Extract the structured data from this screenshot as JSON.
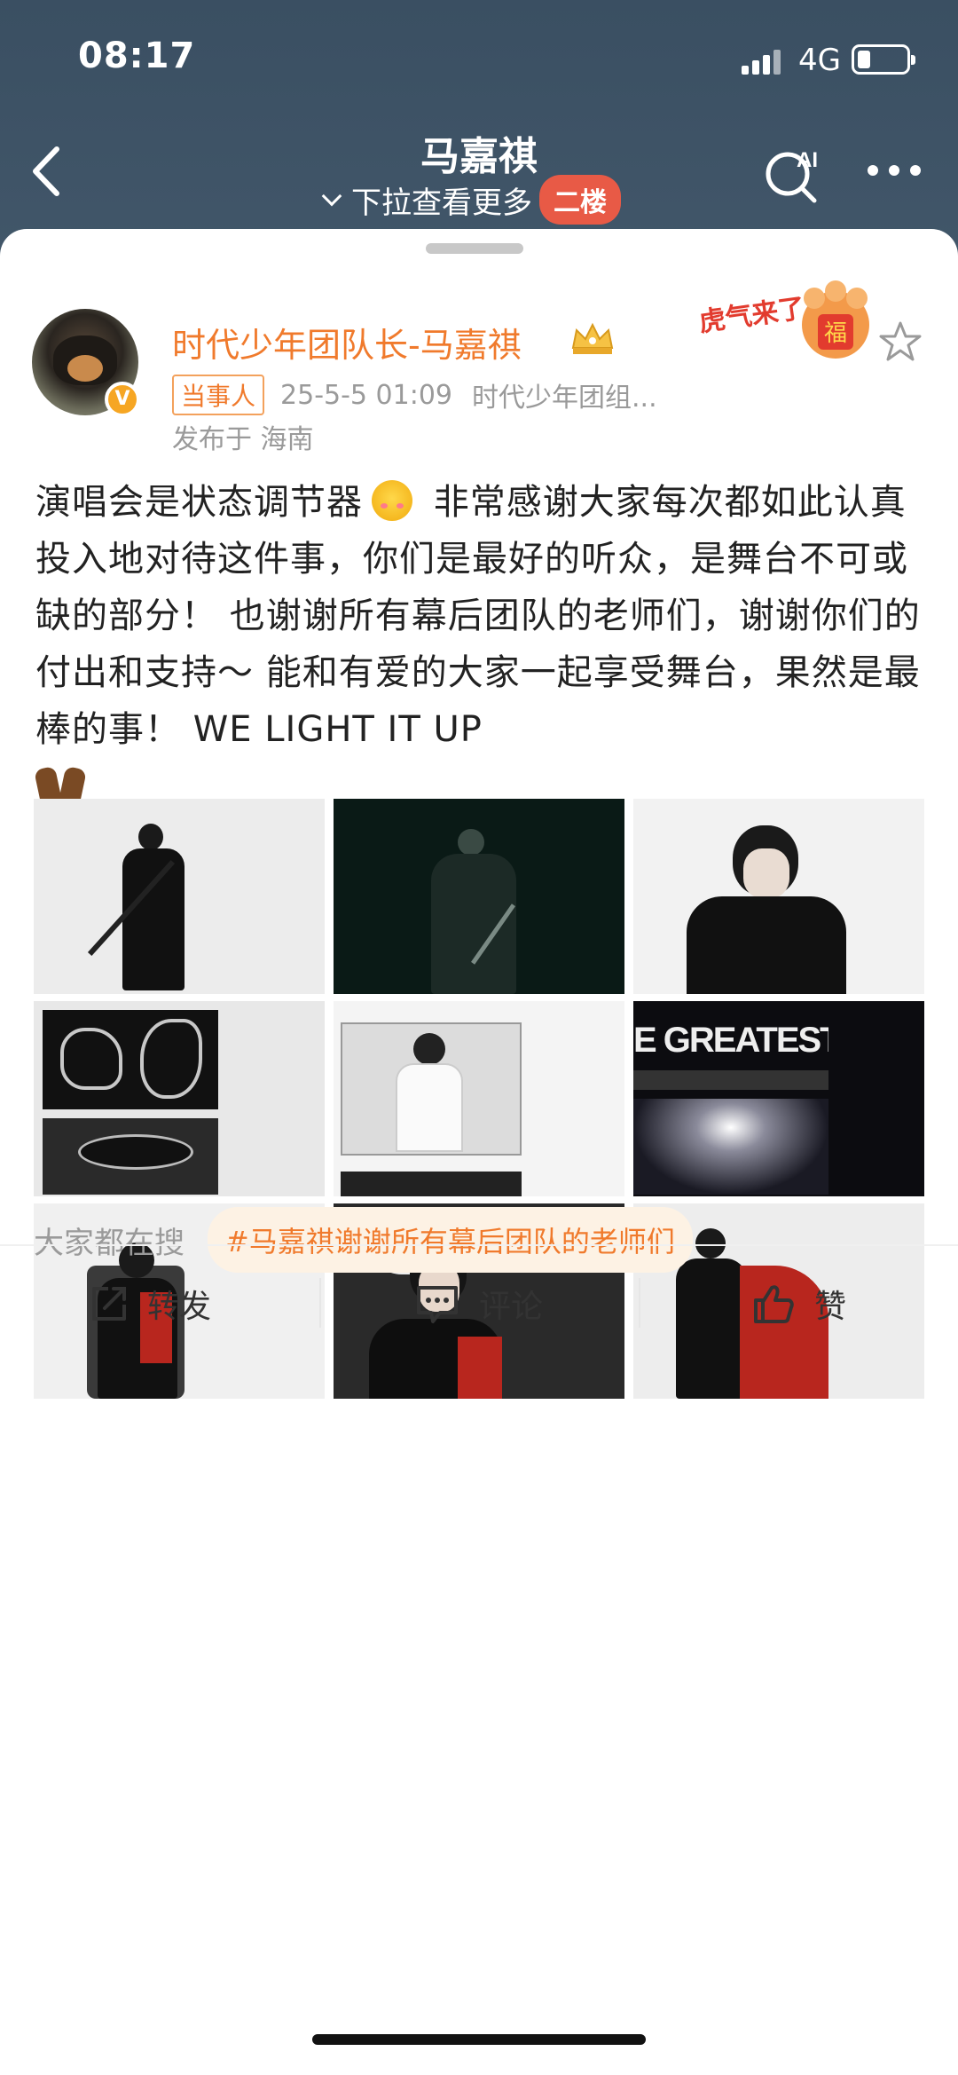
{
  "status_bar": {
    "time": "08:17",
    "network": "4G"
  },
  "nav": {
    "title": "马嘉祺",
    "subtitle": "下拉查看更多",
    "floor_badge": "二楼",
    "ai_label": "AI"
  },
  "post": {
    "author": "时代少年团队长-马嘉祺",
    "tag": "当事人",
    "time": "25-5-5 01:09",
    "source": "时代少年团组...",
    "location": "发布于 海南",
    "sticker_text": "虎气来了",
    "text_part1": "演唱会是状态调节器",
    "text_part2": " 非常感谢大家每次都如此认真投入地对待这件事，你们是最好的听众，是舞台不可或缺的部分！ 也谢谢所有幕后团队的老师们，谢谢你们的付出和支持～ 能和有爱的大家一起享受舞台，果然是最棒的事！ WE LIGHT IT UP",
    "emoji_1": "smiling-face-with-hearts-icon",
    "emoji_2": "raising-hands-icon",
    "photo_text": "E GREATEST SH"
  },
  "trending": {
    "label": "大家都在搜",
    "topic": "#马嘉祺谢谢所有幕后团队的老师们"
  },
  "actions": {
    "repost": "转发",
    "comment": "评论",
    "like": "赞"
  },
  "colors": {
    "header_bg": "#3e5365",
    "author_orange": "#f07a2c",
    "badge_red": "#e85a46"
  }
}
